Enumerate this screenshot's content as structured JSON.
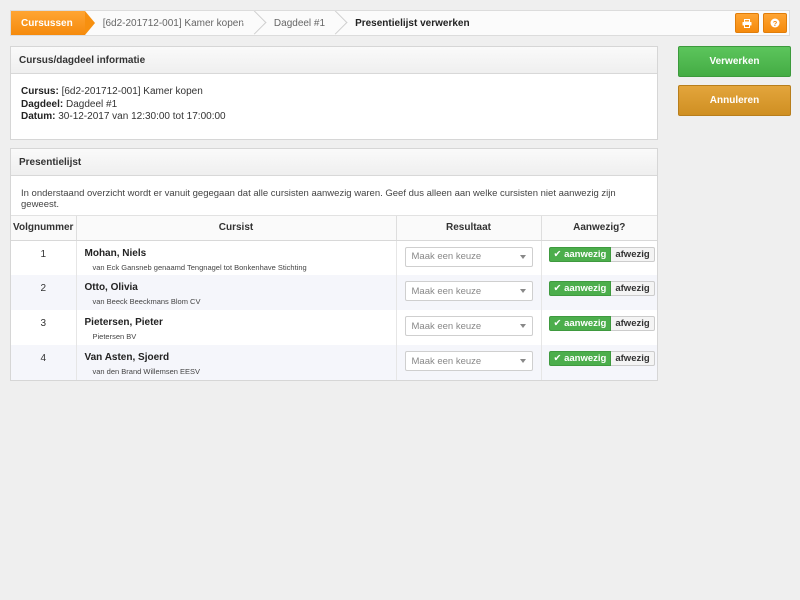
{
  "breadcrumb": {
    "items": [
      "Cursussen",
      "[6d2-201712-001] Kamer kopen",
      "Dagdeel #1",
      "Presentielijst verwerken"
    ]
  },
  "icons": {
    "print": "print-icon",
    "help": "help-icon"
  },
  "info_panel": {
    "title": "Cursus/dagdeel informatie",
    "cursus_label": "Cursus:",
    "cursus_value": "[6d2-201712-001] Kamer kopen",
    "dagdeel_label": "Dagdeel:",
    "dagdeel_value": "Dagdeel #1",
    "datum_label": "Datum:",
    "datum_value": "30-12-2017 van 12:30:00 tot 17:00:00"
  },
  "list_panel": {
    "title": "Presentielijst",
    "intro": "In onderstaand overzicht wordt er vanuit gegegaan dat alle cursisten aanwezig waren. Geef dus alleen aan welke cursisten niet aanwezig zijn geweest.",
    "columns": [
      "Volgnummer",
      "Cursist",
      "Resultaat",
      "Aanwezig?"
    ],
    "rows": [
      {
        "num": "1",
        "name": "Mohan, Niels",
        "company": "van Eck Gansneb genaamd Tengnagel tot Bonkenhave Stichting",
        "result_placeholder": "Maak een keuze",
        "present": "aanwezig",
        "absent": "afwezig"
      },
      {
        "num": "2",
        "name": "Otto, Olivia",
        "company": "van Beeck Beeckmans Blom CV",
        "result_placeholder": "Maak een keuze",
        "present": "aanwezig",
        "absent": "afwezig"
      },
      {
        "num": "3",
        "name": "Pietersen, Pieter",
        "company": "Pietersen BV",
        "result_placeholder": "Maak een keuze",
        "present": "aanwezig",
        "absent": "afwezig"
      },
      {
        "num": "4",
        "name": "Van Asten, Sjoerd",
        "company": "van den Brand Willemsen EESV",
        "result_placeholder": "Maak een keuze",
        "present": "aanwezig",
        "absent": "afwezig"
      }
    ]
  },
  "actions": {
    "process_label": "Verwerken",
    "cancel_label": "Annuleren"
  },
  "colors": {
    "accent_orange": "#f7900f",
    "success_green": "#4cae4c",
    "cancel_orange": "#d99a2e"
  }
}
